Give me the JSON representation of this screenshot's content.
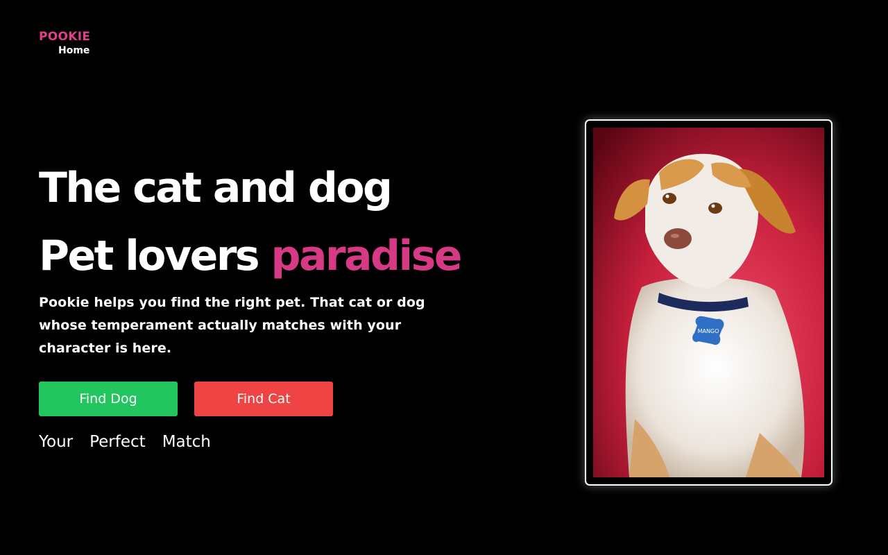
{
  "brand": {
    "name": "POOKIE",
    "nav_home": "Home"
  },
  "hero": {
    "line1": "The cat and dog",
    "line2_prefix": "Pet lovers",
    "line2_accent": "paradise",
    "description": "Pookie helps you find the right pet. That cat or dog whose temperament actually matches with your character is here."
  },
  "buttons": {
    "find_dog": "Find Dog",
    "find_cat": "Find Cat"
  },
  "tagline": [
    "Your",
    "Perfect",
    "Match"
  ],
  "photo": {
    "tag_text": "MANGO"
  },
  "colors": {
    "accent": "#d63a85",
    "brand": "#e0408a",
    "dog_button": "#22c55e",
    "cat_button": "#ef4444",
    "background": "#000000"
  }
}
